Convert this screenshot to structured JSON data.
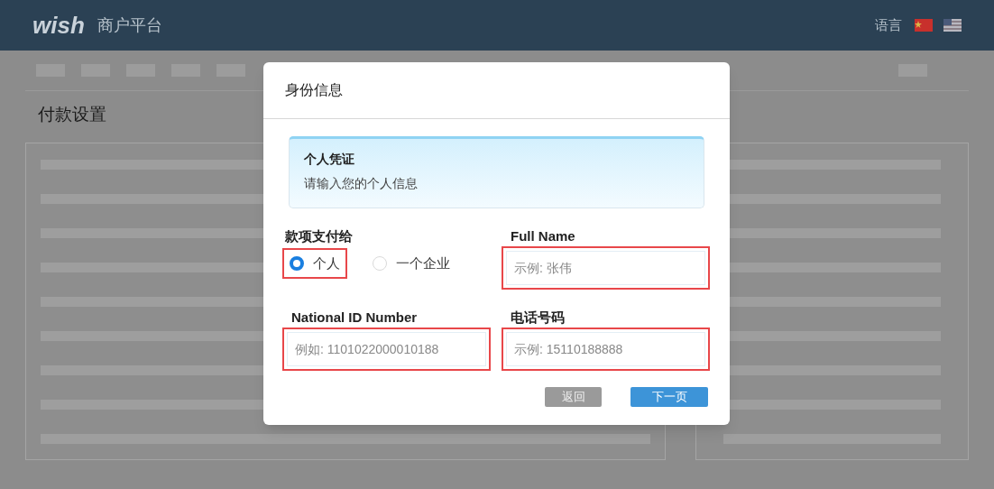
{
  "header": {
    "logo": "wish",
    "title": "商户平台",
    "language_label": "语言"
  },
  "page": {
    "title": "付款设置"
  },
  "dialog": {
    "title": "身份信息",
    "notice": {
      "title": "个人凭证",
      "text": "请输入您的个人信息"
    },
    "payee": {
      "label": "款项支付给",
      "options": [
        {
          "label": "个人",
          "selected": true,
          "highlighted": true
        },
        {
          "label": "一个企业",
          "selected": false,
          "highlighted": false
        }
      ]
    },
    "fields": [
      {
        "label": "Full Name",
        "placeholder": "示例: 张伟",
        "highlighted": true
      },
      {
        "label": "National ID Number",
        "placeholder": "例如: 1101022000010188",
        "highlighted": true
      },
      {
        "label": "电话号码",
        "placeholder": "示例: 15110188888",
        "highlighted": true
      }
    ],
    "buttons": [
      {
        "label": "返回",
        "kind": "secondary"
      },
      {
        "label": "下一页",
        "kind": "primary"
      }
    ]
  }
}
